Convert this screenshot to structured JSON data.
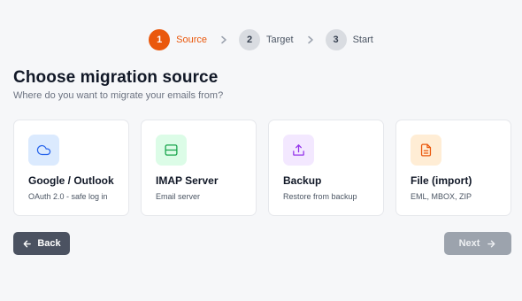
{
  "stepper": {
    "steps": [
      {
        "number": "1",
        "label": "Source"
      },
      {
        "number": "2",
        "label": "Target"
      },
      {
        "number": "3",
        "label": "Start"
      }
    ]
  },
  "heading": {
    "title": "Choose migration source",
    "subtitle": "Where do you want to migrate your emails from?"
  },
  "sources": [
    {
      "title": "Google / Outlook",
      "description": "OAuth 2.0 - safe log in",
      "icon": "cloud-icon"
    },
    {
      "title": "IMAP Server",
      "description": "Email server",
      "icon": "server-icon"
    },
    {
      "title": "Backup",
      "description": "Restore from backup",
      "icon": "upload-icon"
    },
    {
      "title": "File (import)",
      "description": "EML, MBOX, ZIP",
      "icon": "file-icon"
    }
  ],
  "footer": {
    "back_label": "Back",
    "next_label": "Next"
  },
  "colors": {
    "accent": "#ea580c",
    "cloud_bg": "#dbeafe",
    "server_bg": "#dcfce7",
    "upload_bg": "#f3e8ff",
    "file_bg": "#ffedd5"
  }
}
